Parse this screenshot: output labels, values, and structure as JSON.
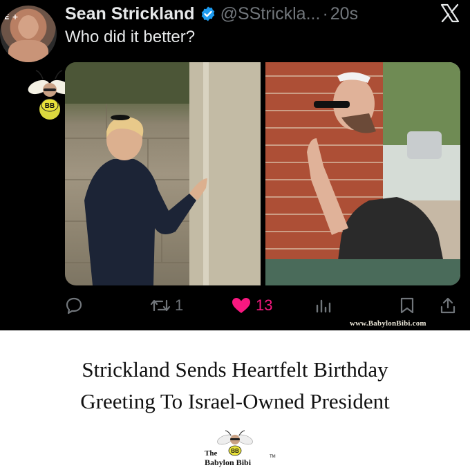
{
  "tweet": {
    "author": {
      "display_name": "Sean Strickland",
      "handle": "@SStrickla...",
      "verified": true,
      "avatar_badge": "E +",
      "timestamp": "20s"
    },
    "text": "Who did it better?",
    "media": {
      "images": [
        {
          "alt": "Man in dark suit touching stone wall"
        },
        {
          "alt": "Man in sunglasses and kippah touching brick wall"
        }
      ]
    },
    "actions": {
      "reply_count": "",
      "retweet_count": "1",
      "like_count": "13",
      "liked": true,
      "colors": {
        "icon": "#71767b",
        "like": "#f91880"
      }
    },
    "watermark_url": "www.BabylonBibi.com"
  },
  "headline": {
    "line1": "Strickland Sends Heartfelt Birthday",
    "line2": "Greeting To Israel-Owned President"
  },
  "brand": {
    "the": "The",
    "name": "Babylon Bibi",
    "mark_text": "BB",
    "tm": "TM"
  },
  "icons": [
    "x-logo-icon",
    "verified-badge-icon",
    "reply-icon",
    "retweet-icon",
    "heart-icon",
    "analytics-icon",
    "bookmark-icon",
    "share-icon",
    "bee-mascot-icon"
  ]
}
